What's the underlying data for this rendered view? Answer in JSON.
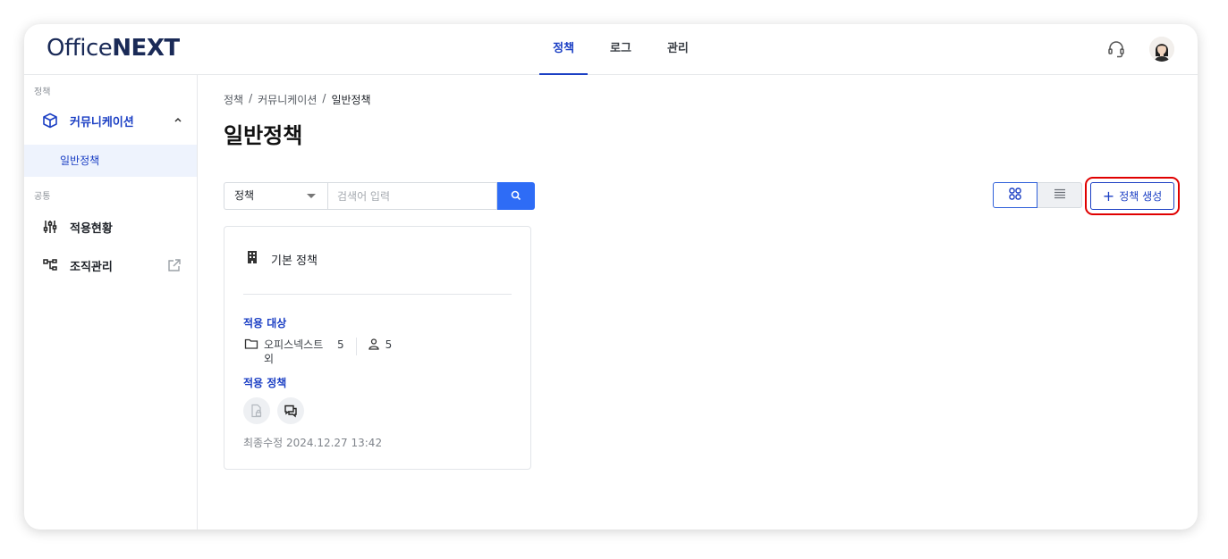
{
  "header": {
    "logo_office": "Office",
    "logo_next": "NEXT",
    "nav": [
      {
        "label": "정책",
        "active": true
      },
      {
        "label": "로그",
        "active": false
      },
      {
        "label": "관리",
        "active": false
      }
    ],
    "icons": [
      "headset-icon",
      "avatar"
    ]
  },
  "sidebar": {
    "section_policy": "정책",
    "communication": {
      "label": "커뮤니케이션",
      "icon": "cube-icon",
      "expanded": true
    },
    "sub_general": "일반정책",
    "section_common": "공통",
    "apply_status": {
      "label": "적용현황",
      "icon": "sliders-icon"
    },
    "org_manage": {
      "label": "조직관리",
      "icon": "org-tree-icon",
      "external": "external-link-icon"
    }
  },
  "main": {
    "breadcrumb": [
      "정책",
      "커뮤니케이션",
      "일반정책"
    ],
    "title": "일반정책",
    "filter": {
      "select_value": "정책",
      "search_placeholder": "검색어 입력"
    },
    "create_label": "정책 생성",
    "card": {
      "title": "기본 정책",
      "apply_target_label": "적용 대상",
      "folder_name": "오피스넥스트 외",
      "folder_count": "5",
      "user_count": "5",
      "apply_policy_label": "적용 정책",
      "modified": "최종수정 2024.12.27 13:42"
    }
  },
  "colors": {
    "brand": "#1a2a57",
    "accent": "#1b3fc4",
    "search_button": "#2e6cf6",
    "highlight_box": "#e00000"
  }
}
